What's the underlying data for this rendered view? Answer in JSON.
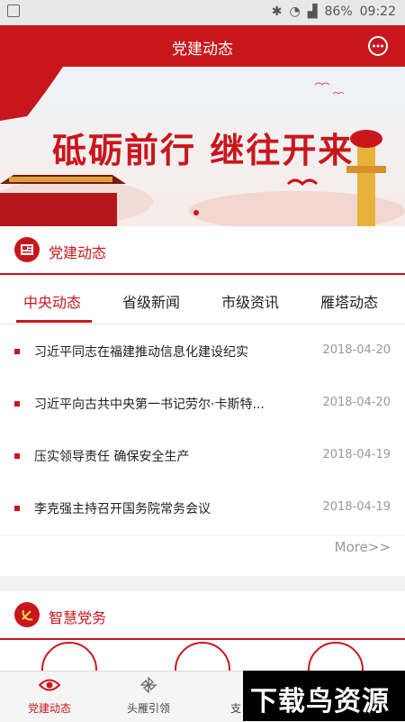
{
  "status_bar": {
    "battery": "86%",
    "time": "09:22"
  },
  "app_bar": {
    "title": "党建动态"
  },
  "banner": {
    "headline": "砥砺前行 继往开来"
  },
  "section_news": {
    "title": "党建动态",
    "tabs": [
      {
        "label": "中央动态",
        "active": true
      },
      {
        "label": "省级新闻",
        "active": false
      },
      {
        "label": "市级资讯",
        "active": false
      },
      {
        "label": "雁塔动态",
        "active": false
      }
    ],
    "items": [
      {
        "title": "习近平同志在福建推动信息化建设纪实",
        "date": "2018-04-20"
      },
      {
        "title": "习近平向古共中央第一书记劳尔·卡斯特...",
        "date": "2018-04-20"
      },
      {
        "title": "压实领导责任 确保安全生产",
        "date": "2018-04-19"
      },
      {
        "title": "李克强主持召开国务院常务会议",
        "date": "2018-04-19"
      }
    ],
    "more_label": "More>>"
  },
  "section_smart": {
    "title": "智慧党务"
  },
  "bottom_nav": [
    {
      "label": "党建动态",
      "icon": "eye-icon",
      "active": true
    },
    {
      "label": "头雁引领",
      "icon": "pinwheel-icon",
      "active": false
    },
    {
      "label": "支",
      "icon": "",
      "active": false
    }
  ],
  "watermark": {
    "text": "下载鸟资源"
  },
  "colors": {
    "primary": "#c9161d",
    "text": "#222222",
    "muted": "#999999"
  }
}
